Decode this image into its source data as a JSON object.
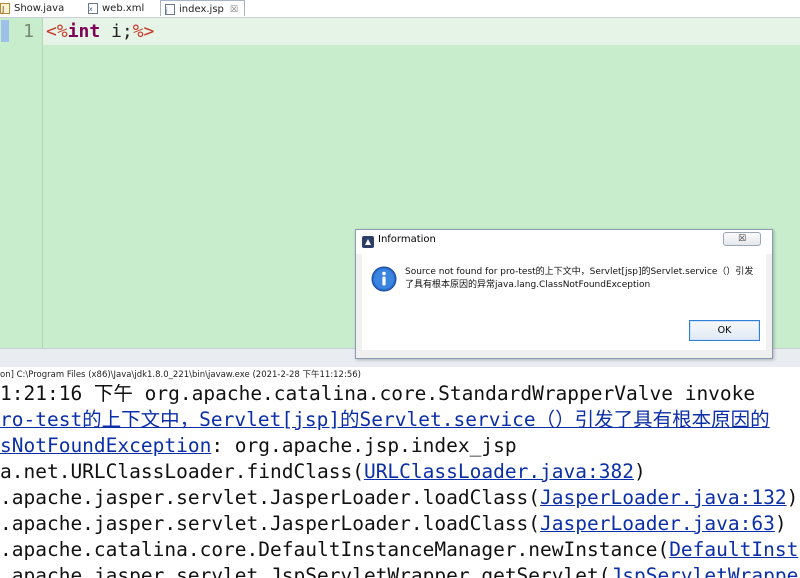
{
  "tabs": [
    {
      "label": "Show.java",
      "icon": "java-file-icon"
    },
    {
      "label": "web.xml",
      "icon": "xml-file-icon"
    },
    {
      "label": "index.jsp",
      "icon": "jsp-file-icon",
      "active": true,
      "close": "☒"
    }
  ],
  "editor": {
    "line_number": "1",
    "code": {
      "open": "<%",
      "keyword": "int",
      "rest": " i;",
      "close": "%>"
    },
    "background": "#c7edcc"
  },
  "console_header": "on] C:\\Program Files (x86)\\Java\\jdk1.8.0_221\\bin\\javaw.exe (2021-2-28 下午11:12:56)",
  "console_lines": [
    [
      {
        "t": "1:21:16 下午 org.apache.catalina.core.StandardWrapperValve invoke"
      }
    ],
    [
      {
        "t": "ro-test的上下文中，Servlet[jsp]的Servlet.service（）引发了具有根本原因的",
        "link": true
      }
    ],
    [
      {
        "t": "sNotFoundException",
        "link": true
      },
      {
        "t": ": org.apache.jsp.index_jsp"
      }
    ],
    [
      {
        "t": "a.net.URLClassLoader.findClass("
      },
      {
        "t": "URLClassLoader.java:382",
        "link": true
      },
      {
        "t": ")"
      }
    ],
    [
      {
        "t": ".apache.jasper.servlet.JasperLoader.loadClass("
      },
      {
        "t": "JasperLoader.java:132",
        "link": true
      },
      {
        "t": ")"
      }
    ],
    [
      {
        "t": ".apache.jasper.servlet.JasperLoader.loadClass("
      },
      {
        "t": "JasperLoader.java:63",
        "link": true
      },
      {
        "t": ")"
      }
    ],
    [
      {
        "t": ".apache.catalina.core.DefaultInstanceManager.newInstance("
      },
      {
        "t": "DefaultInst",
        "link": true
      }
    ],
    [
      {
        "t": ".apache.jasper.servlet.JspServletWrapper.getServlet("
      },
      {
        "t": "JspServletWrappe",
        "link": true
      }
    ]
  ],
  "dialog": {
    "title": "Information",
    "close_label": "☒",
    "message": "Source not found for pro-test的上下文中，Servlet[jsp]的Servlet.service（）引发了具有根本原因的异常java.lang.ClassNotFoundException",
    "ok_label": "OK"
  },
  "colors": {
    "link": "#0b2fa8",
    "jsp_delim": "#c63a2b",
    "keyword": "#7f0055",
    "ok_border": "#2f7fd7"
  }
}
